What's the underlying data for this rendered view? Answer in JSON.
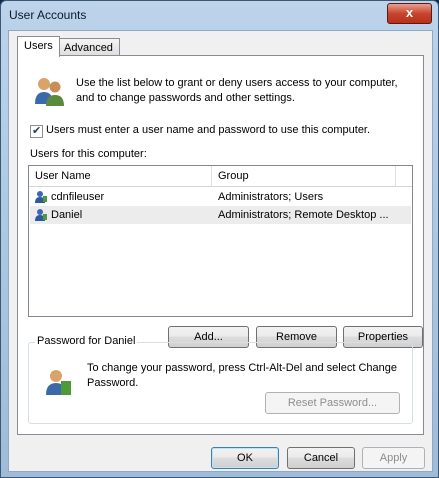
{
  "window": {
    "title": "User Accounts",
    "close_glyph": "x"
  },
  "tabs": [
    {
      "label": "Users",
      "active": true
    },
    {
      "label": "Advanced",
      "active": false
    }
  ],
  "intro": {
    "icon": "users-icon",
    "text": "Use the list below to grant or deny users access to your computer, and to change passwords and other settings."
  },
  "require_login": {
    "checked": true,
    "label": "Users must enter a user name and password to use this computer."
  },
  "users_list": {
    "label": "Users for this computer:",
    "columns": [
      "User Name",
      "Group"
    ],
    "rows": [
      {
        "name": "cdnfileuser",
        "group": "Administrators; Users",
        "selected": false
      },
      {
        "name": "Daniel",
        "group": "Administrators; Remote Desktop ...",
        "selected": true
      }
    ]
  },
  "list_buttons": {
    "add": "Add...",
    "remove": "Remove",
    "properties": "Properties"
  },
  "password_group": {
    "title": "Password for Daniel",
    "text": "To change your password, press Ctrl-Alt-Del and select Change Password.",
    "reset_button": "Reset Password..."
  },
  "dialog_buttons": {
    "ok": "OK",
    "cancel": "Cancel",
    "apply": "Apply"
  },
  "colors": {
    "title_bar": "#bcd3ea",
    "close_button": "#c8442e",
    "selection": "#ececec"
  }
}
